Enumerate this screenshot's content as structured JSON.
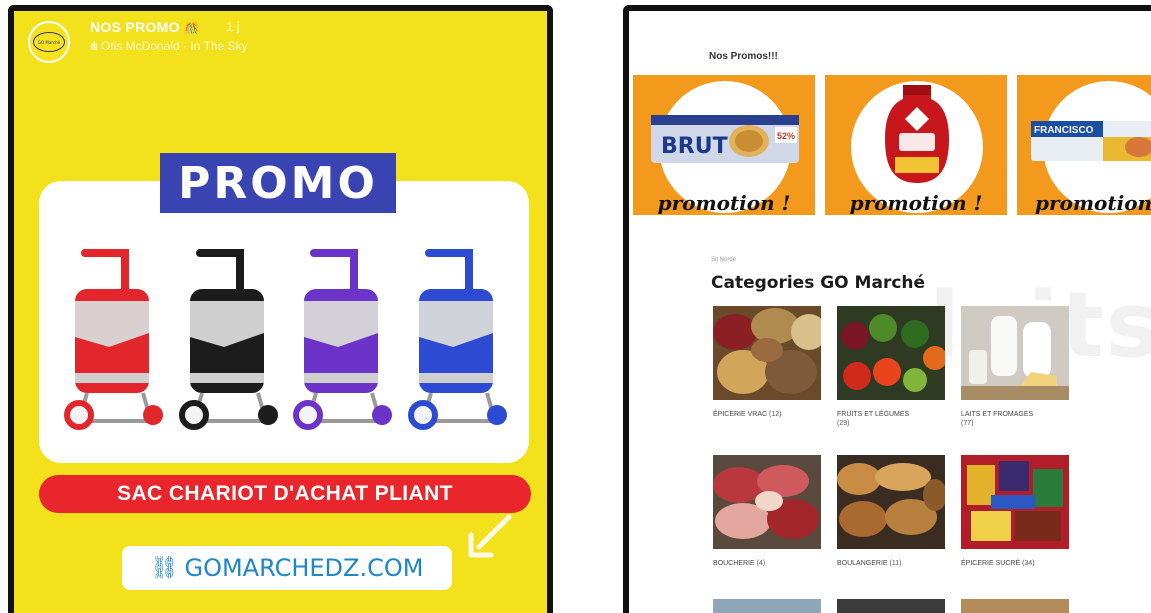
{
  "story": {
    "title": "NOS PROMO",
    "title_emoji": "🎊",
    "time": "1 j",
    "music_bars": "ılı",
    "music": "Otis McDonald · In The Sky",
    "badge": "PROMO",
    "product": "SAC CHARIOT D'ACHAT PLIANT",
    "website": "GOMARCHEDZ.COM",
    "link_icon": "🔗",
    "bag_colors": [
      "#e2262c",
      "#1c1c1c",
      "#6b33c8",
      "#2d4bd2"
    ],
    "colors": {
      "background": "#f3e11b",
      "badge": "#3a43b2",
      "ribbon": "#e8262b",
      "link": "#1f86c8"
    }
  },
  "site": {
    "promos_title": "Nos Promos!!!",
    "promo_tiles": [
      {
        "label": "promotion !",
        "product_text": "BRUT"
      },
      {
        "label": "promotion !",
        "product_text": ""
      },
      {
        "label": "promotion",
        "product_text": "FRANCISCO"
      }
    ],
    "bg_word": "luits",
    "categories_eyebrow": "Sit Nordé",
    "categories_title": "Categories GO Marché",
    "categories": [
      {
        "name": "ÉPICERIE VRAC",
        "count": "(12)"
      },
      {
        "name": "FRUITS ET LÉGUMES",
        "count": "(29)"
      },
      {
        "name": "LAITS ET FROMAGES",
        "count": "(77)"
      },
      {
        "name": "BOUCHERIE",
        "count": "(4)"
      },
      {
        "name": "BOULANGERIE",
        "count": "(11)"
      },
      {
        "name": "ÉPICERIE SUCRÉ",
        "count": "(34)"
      }
    ],
    "colors": {
      "tile": "#f39a1c"
    }
  }
}
